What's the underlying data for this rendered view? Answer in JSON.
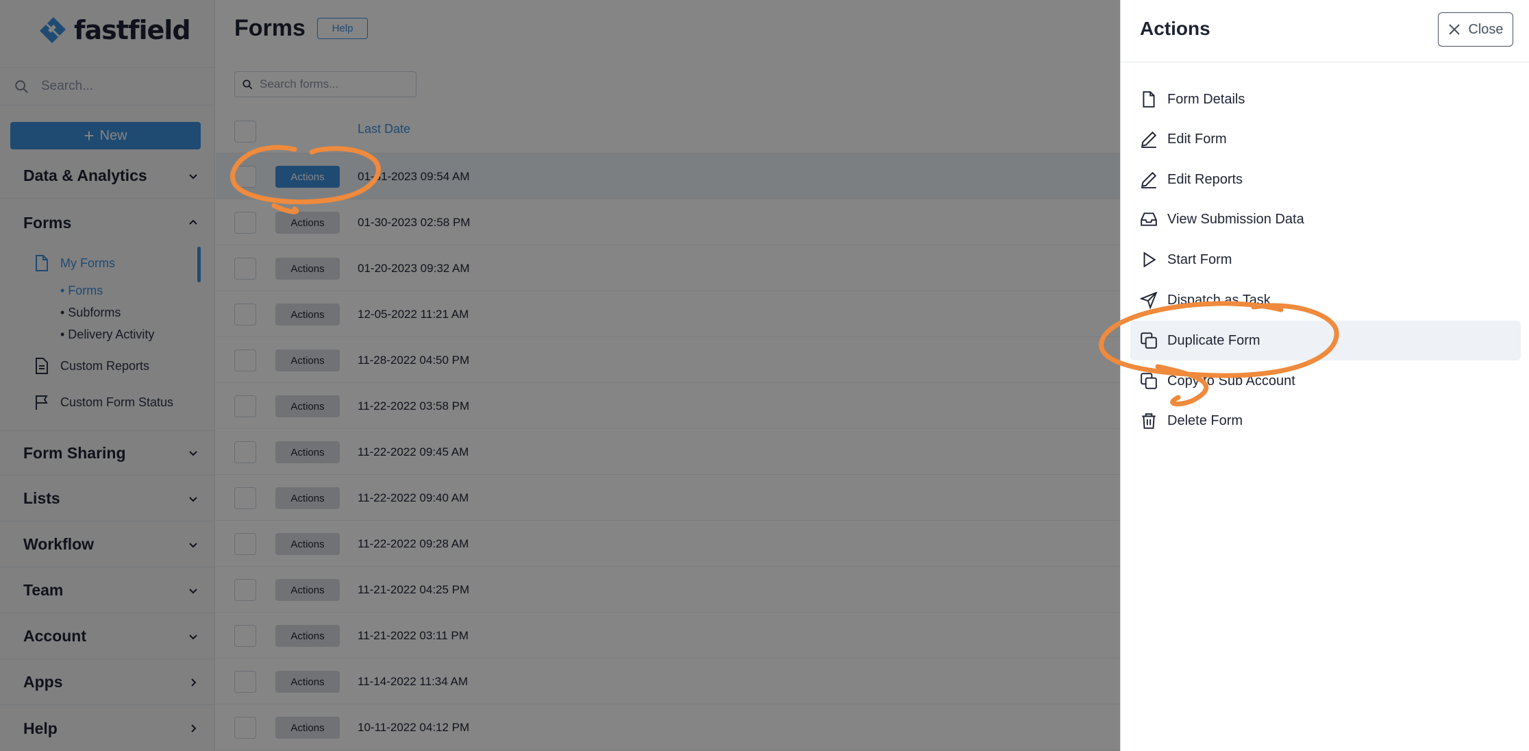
{
  "brand": {
    "name": "fastfield"
  },
  "sidebar": {
    "search_placeholder": "Search...",
    "new_label": "New",
    "sections": [
      {
        "label": "Data & Analytics"
      },
      {
        "label": "Forms"
      },
      {
        "label": "Form Sharing"
      },
      {
        "label": "Lists"
      },
      {
        "label": "Workflow"
      },
      {
        "label": "Team"
      },
      {
        "label": "Account"
      },
      {
        "label": "Apps"
      },
      {
        "label": "Help"
      }
    ],
    "forms_children": {
      "my_forms": "My Forms",
      "forms": "• Forms",
      "subforms": "• Subforms",
      "delivery_activity": "• Delivery Activity",
      "custom_reports": "Custom Reports",
      "custom_form_status": "Custom Form Status"
    }
  },
  "main": {
    "title": "Forms",
    "help_label": "Help",
    "search_placeholder": "Search forms...",
    "column_last_date": "Last Date",
    "action_label": "Actions",
    "rows": [
      {
        "date": "01-31-2023 09:54 AM"
      },
      {
        "date": "01-30-2023 02:58 PM"
      },
      {
        "date": "01-20-2023 09:32 AM"
      },
      {
        "date": "12-05-2022 11:21 AM"
      },
      {
        "date": "11-28-2022 04:50 PM"
      },
      {
        "date": "11-22-2022 03:58 PM"
      },
      {
        "date": "11-22-2022 09:45 AM"
      },
      {
        "date": "11-22-2022 09:40 AM"
      },
      {
        "date": "11-22-2022 09:28 AM"
      },
      {
        "date": "11-21-2022 04:25 PM"
      },
      {
        "date": "11-21-2022 03:11 PM"
      },
      {
        "date": "11-14-2022 11:34 AM"
      },
      {
        "date": "10-11-2022 04:12 PM"
      }
    ]
  },
  "drawer": {
    "title": "Actions",
    "close_label": "Close",
    "items": [
      {
        "label": "Form Details",
        "icon": "file-icon"
      },
      {
        "label": "Edit Form",
        "icon": "pencil-icon"
      },
      {
        "label": "Edit Reports",
        "icon": "pencil-icon"
      },
      {
        "label": "View Submission Data",
        "icon": "inbox-icon"
      },
      {
        "label": "Start Form",
        "icon": "play-icon"
      },
      {
        "label": "Dispatch as Task",
        "icon": "send-icon"
      },
      {
        "label": "Duplicate Form",
        "icon": "copy-icon"
      },
      {
        "label": "Copy to Sub Account",
        "icon": "copy-icon"
      },
      {
        "label": "Delete Form",
        "icon": "trash-icon"
      }
    ]
  },
  "colors": {
    "accent": "#3d8fdb",
    "annotation": "#f08a3c",
    "overlay": "rgba(0,0,0,0.48)"
  }
}
